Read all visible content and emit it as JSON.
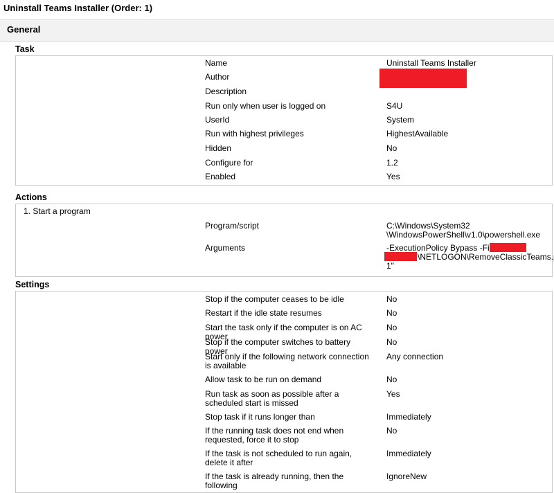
{
  "window": {
    "title": "Uninstall Teams Installer (Order: 1)"
  },
  "general": {
    "label": "General"
  },
  "task": {
    "label": "Task",
    "rows": [
      {
        "name": "Name",
        "value": "Uninstall Teams Installer"
      },
      {
        "name": "Author",
        "value": ""
      },
      {
        "name": "Description",
        "value": ""
      },
      {
        "name": "Run only when user is logged on",
        "value": "S4U"
      },
      {
        "name": "UserId",
        "value": "System"
      },
      {
        "name": "Run with highest privileges",
        "value": "HighestAvailable"
      },
      {
        "name": "Hidden",
        "value": "No"
      },
      {
        "name": "Configure for",
        "value": "1.2"
      },
      {
        "name": "Enabled",
        "value": "Yes"
      }
    ]
  },
  "actions": {
    "label": "Actions",
    "item_label": "1. Start a program",
    "program_label": "Program/script",
    "program_value": "C:\\Windows\\System32\n\\WindowsPowerShell\\v1.0\\powershell.exe",
    "arguments_label": "Arguments",
    "arguments_line1": "-ExecutionPolicy Bypass -File \"\\\\",
    "arguments_line2": "\\NETLOGON\\RemoveClassicTeams.ps",
    "arguments_line3": "1\""
  },
  "settings": {
    "label": "Settings",
    "rows": [
      {
        "name": "Stop if the computer ceases to be idle",
        "value": "No"
      },
      {
        "name": "Restart if the idle state resumes",
        "value": "No"
      },
      {
        "name": "Start the task only if the computer is on AC power",
        "value": "No"
      },
      {
        "name": "Stop if the computer switches to battery power",
        "value": "No"
      },
      {
        "name": "Start only if the following network connection is available",
        "value": "Any connection"
      },
      {
        "name": "Allow task to be run on demand",
        "value": "No"
      },
      {
        "name": "Run task as soon as possible after a scheduled start is missed",
        "value": "Yes"
      },
      {
        "name": "Stop task if it runs longer than",
        "value": "Immediately"
      },
      {
        "name": "If the running task does not end when requested, force it to stop",
        "value": "No"
      },
      {
        "name": "If the task is not scheduled to run again, delete it after",
        "value": "Immediately"
      },
      {
        "name": "If the task is already running, then the following",
        "value": "IgnoreNew"
      }
    ]
  },
  "colors": {
    "redaction": "#ee1c25"
  }
}
